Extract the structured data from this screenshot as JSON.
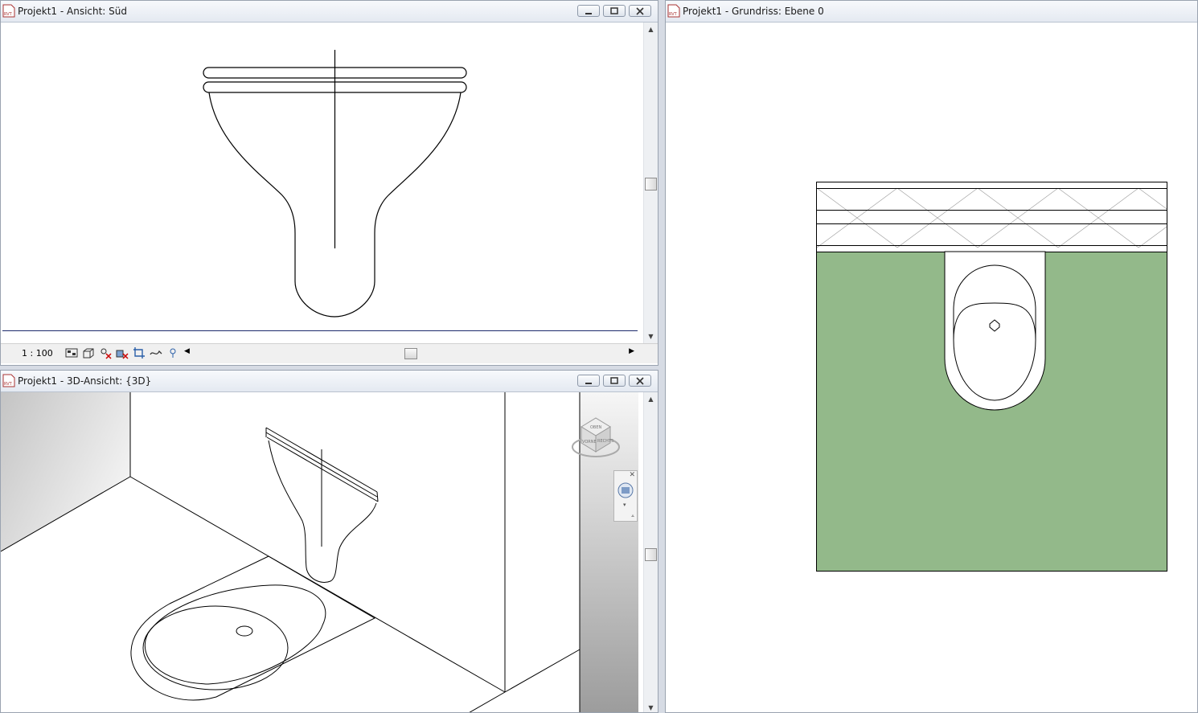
{
  "windows": {
    "south": {
      "title": "Projekt1 - Ansicht: Süd",
      "scale": "1 : 100"
    },
    "view3d": {
      "title": "Projekt1 - 3D-Ansicht: {3D}"
    },
    "plan": {
      "title": "Projekt1 - Grundriss: Ebene 0"
    }
  },
  "app_icon_label": "RVT",
  "viewcube": {
    "faces": [
      "OBEN",
      "VORNE",
      "RECHTS"
    ]
  },
  "colors": {
    "floor": "#93b98a",
    "titlebar": "#e9edf3",
    "drawing": "#000000"
  }
}
